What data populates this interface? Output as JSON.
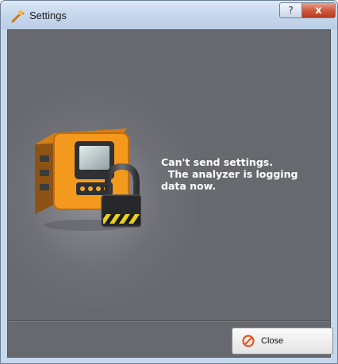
{
  "window": {
    "title": "Settings",
    "app_icon": "wrench-icon",
    "help_glyph": "?",
    "close_glyph": "x"
  },
  "message": {
    "text": "Can't send settings.\n  The analyzer is logging data now."
  },
  "illustration": {
    "device_icon": "locked-analyzer-icon"
  },
  "buttons": {
    "close_label": "Close",
    "close_icon": "no-entry-icon"
  },
  "colors": {
    "client_bg": "#68696f",
    "device_orange": "#f39a1e",
    "close_icon_orange": "#e8541e",
    "titlebar_close_red": "#c9462a"
  }
}
